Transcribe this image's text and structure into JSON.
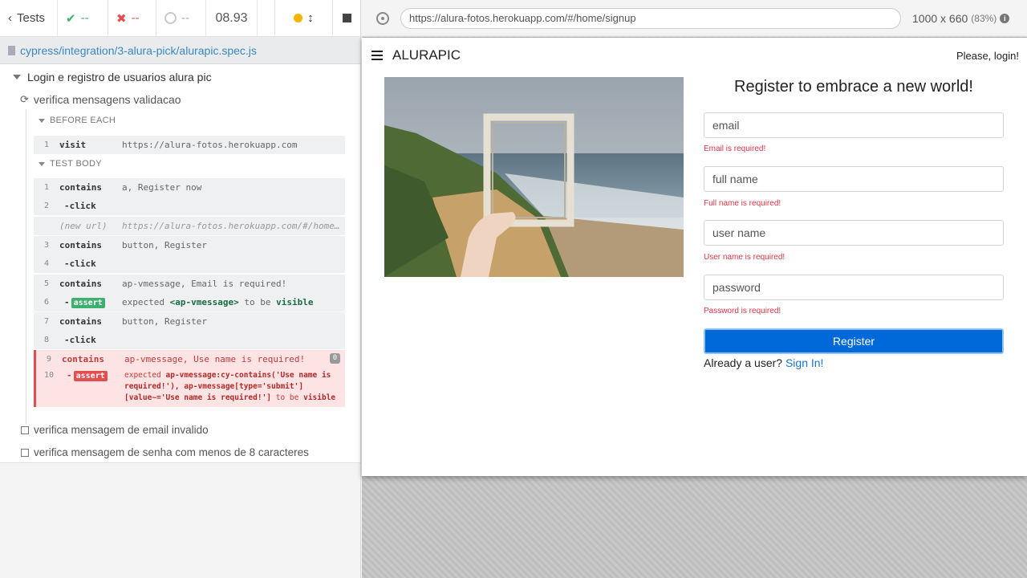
{
  "runner": {
    "tests_label": "Tests",
    "passed_count": "--",
    "failed_count": "--",
    "pending_count": "--",
    "duration": "08.93",
    "spec_path": "cypress/integration/3-alura-pick/alurapic.spec.js"
  },
  "suite": {
    "title": "Login e registro de usuarios alura pic",
    "current_test": "verifica mensagens validacao",
    "before_each_label": "BEFORE EACH",
    "test_body_label": "TEST BODY",
    "before_each": [
      {
        "num": "1",
        "name": "visit",
        "msg": "https://alura-fotos.herokuapp.com"
      }
    ],
    "commands": [
      {
        "num": "1",
        "name": "contains",
        "msg": "a, Register now"
      },
      {
        "num": "2",
        "name": "-click",
        "msg": ""
      },
      {
        "num": "",
        "name": "(new url)",
        "msg": "https://alura-fotos.herokuapp.com/#/home/signup"
      },
      {
        "num": "3",
        "name": "contains",
        "msg": "button, Register"
      },
      {
        "num": "4",
        "name": "-click",
        "msg": ""
      },
      {
        "num": "5",
        "name": "contains",
        "msg": "ap-vmessage, Email is required!"
      },
      {
        "num": "6",
        "name": "assert",
        "msg_pre": "expected",
        "msg_el": "<ap-vmessage>",
        "msg_mid": "to be",
        "msg_end": "visible"
      },
      {
        "num": "7",
        "name": "contains",
        "msg": "button, Register"
      },
      {
        "num": "8",
        "name": "-click",
        "msg": ""
      },
      {
        "num": "9",
        "name": "contains",
        "msg": "ap-vmessage, Use name is required!"
      },
      {
        "num": "10",
        "name": "assert",
        "fail_pre": "expected",
        "fail_sel": "ap-vmessage:cy-contains('Use name is required!'), ap-vmessage[type='submit'][value~='Use name is required!']",
        "fail_mid": "to be",
        "fail_end": "visible"
      }
    ],
    "error_badge": "0",
    "pending_tests": [
      "verifica mensagem de email invalido",
      "verifica mensagem de senha com menos de 8 caracteres"
    ]
  },
  "preview": {
    "url": "https://alura-fotos.herokuapp.com/#/home/signup",
    "viewport": "1000 x 660",
    "zoom": "(83%)"
  },
  "app": {
    "brand": "ALURAPIC",
    "login_link": "Please, login!",
    "form_title": "Register to embrace a new world!",
    "fields": [
      {
        "placeholder": "email",
        "error": "Email is required!"
      },
      {
        "placeholder": "full name",
        "error": "Full name is required!"
      },
      {
        "placeholder": "user name",
        "error": "User name is required!"
      },
      {
        "placeholder": "password",
        "error": "Password is required!"
      }
    ],
    "register_label": "Register",
    "signin_prompt": "Already a user?",
    "signin_link": "Sign In!"
  }
}
